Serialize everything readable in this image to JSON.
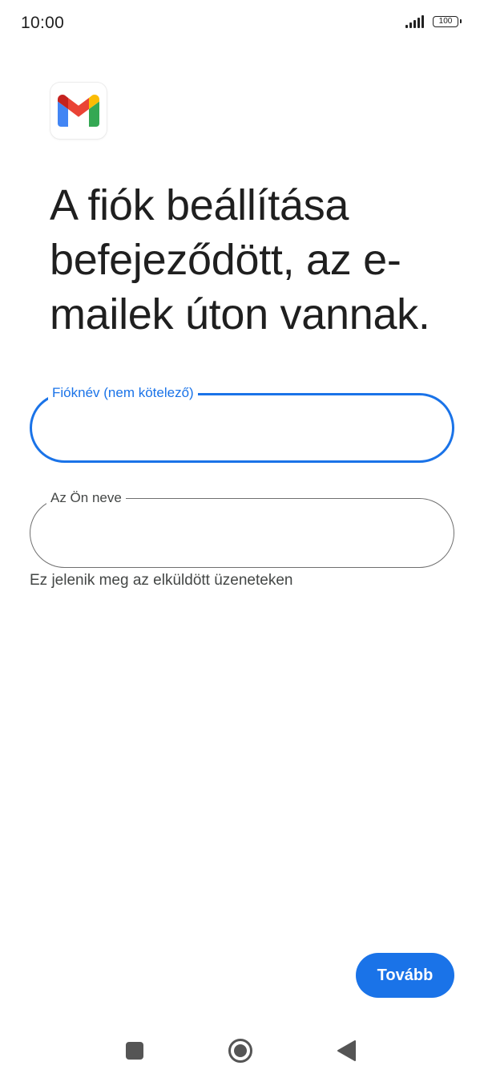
{
  "status_bar": {
    "time": "10:00",
    "battery_level": "100",
    "icons": [
      "signal-icon",
      "battery-icon"
    ]
  },
  "app": {
    "logo_icon": "gmail-logo-icon"
  },
  "page": {
    "title": "A fiók beállítása befejeződött, az e-mailek úton vannak."
  },
  "form": {
    "account_name": {
      "label": "Fióknév (nem kötelező)",
      "value": "",
      "placeholder": "",
      "focused": true
    },
    "your_name": {
      "label": "Az Ön neve",
      "value": "",
      "placeholder": "",
      "helper": "Ez jelenik meg az elküldött üzeneteken"
    }
  },
  "actions": {
    "next_label": "Tovább"
  },
  "nav_bar": {
    "icons": [
      "recents-icon",
      "home-icon",
      "back-icon"
    ]
  },
  "colors": {
    "accent": "#1a73e8",
    "text_primary": "#1f1f1f",
    "text_secondary": "#444746",
    "outline": "#6f6f6f",
    "gmail_red": "#ea4335",
    "gmail_blue": "#4285f4",
    "gmail_green": "#34a853",
    "gmail_yellow": "#fbbc04",
    "gmail_dark_red": "#c5221f"
  }
}
